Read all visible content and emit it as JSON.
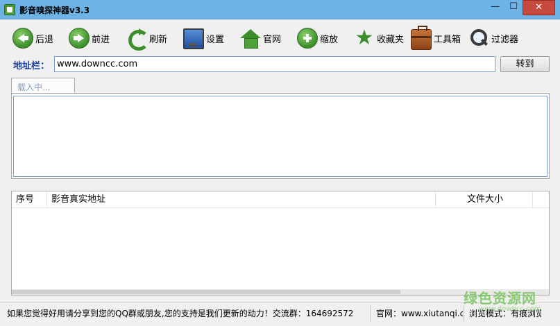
{
  "window": {
    "title": "影音嗅探神器v3.3",
    "min_glyph": "—",
    "max_glyph": "☐",
    "close_glyph": "✕"
  },
  "toolbar": {
    "items": [
      {
        "label": "后退",
        "icon": "back-arrow-icon"
      },
      {
        "label": "前进",
        "icon": "forward-arrow-icon"
      },
      {
        "label": "刷新",
        "icon": "refresh-icon"
      },
      {
        "label": "设置",
        "icon": "monitor-icon"
      },
      {
        "label": "官网",
        "icon": "home-icon"
      },
      {
        "label": "缩放",
        "icon": "plus-icon"
      },
      {
        "label": "收藏夹",
        "icon": "star-icon"
      },
      {
        "label": "工具箱",
        "icon": "toolbox-icon"
      },
      {
        "label": "过滤器",
        "icon": "magnifier-icon"
      }
    ]
  },
  "address": {
    "label": "地址栏：",
    "value": "www.downcc.com",
    "go_label": "转到"
  },
  "browser": {
    "tab_label": "载入中..."
  },
  "list": {
    "columns": [
      "序号",
      "影音真实地址",
      "文件大小"
    ]
  },
  "status": {
    "message": "如果您觉得好用请分享到您的QQ群或朋友,您的支持是我们更新的动力！交流群：164692572",
    "site": "官网：www.xiutanqi.cc",
    "mode": "浏览模式：有痕浏览"
  },
  "watermark": {
    "text": "绿色资源网",
    "sub": "www.downcc.com"
  },
  "colors": {
    "titlebar": "#6eb3e6",
    "accent_green": "#3b8f2a",
    "address_label": "#1a3ea0",
    "close_button": "#c74a3e"
  }
}
